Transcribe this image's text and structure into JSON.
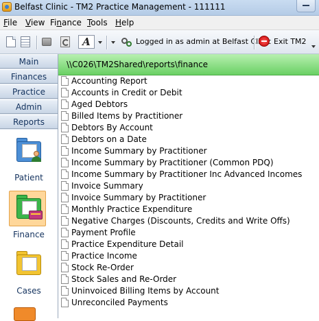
{
  "window": {
    "title": "Belfast Clinic - TM2 Practice Management - 111111"
  },
  "menu": {
    "items": [
      {
        "label": "File",
        "accel": "F"
      },
      {
        "label": "View",
        "accel": "V"
      },
      {
        "label": "Finance",
        "accel": "n"
      },
      {
        "label": "Tools",
        "accel": "T"
      },
      {
        "label": "Help",
        "accel": "H"
      }
    ]
  },
  "toolbar": {
    "font_glyph": "A",
    "login_status": "Logged in as admin at Belfast Clinic",
    "exit_label": "Exit TM2"
  },
  "nav": {
    "tabs": [
      "Main",
      "Finances",
      "Practice",
      "Admin",
      "Reports"
    ],
    "modules": [
      {
        "label": "Patient",
        "icon": "patient-folder-icon"
      },
      {
        "label": "Finance",
        "icon": "finance-folder-icon",
        "selected": true
      },
      {
        "label": "Cases",
        "icon": "cases-folder-icon"
      }
    ]
  },
  "content": {
    "path": "\\\\C026\\TM2Shared\\reports\\finance",
    "header_color": "#6ad064",
    "reports": [
      "Accounting Report",
      "Accounts in Credit or Debit",
      "Aged Debtors",
      "Billed Items by Practitioner",
      "Debtors By Account",
      "Debtors on a Date",
      "Income Summary by Practitioner",
      "Income Summary by Practitioner (Common PDQ)",
      "Income Summary by Practitioner Inc Advanced Incomes",
      "Invoice Summary",
      "Invoice Summary by Practitioner",
      "Monthly Practice Expenditure",
      "Negative Charges (Discounts, Credits and Write Offs)",
      "Payment Profile",
      "Practice Expenditure Detail",
      "Practice Income",
      "Stock Re-Order",
      "Stock Sales and Re-Order",
      "Uninvoiced Billing Items by Account",
      "Unreconciled Payments"
    ]
  }
}
